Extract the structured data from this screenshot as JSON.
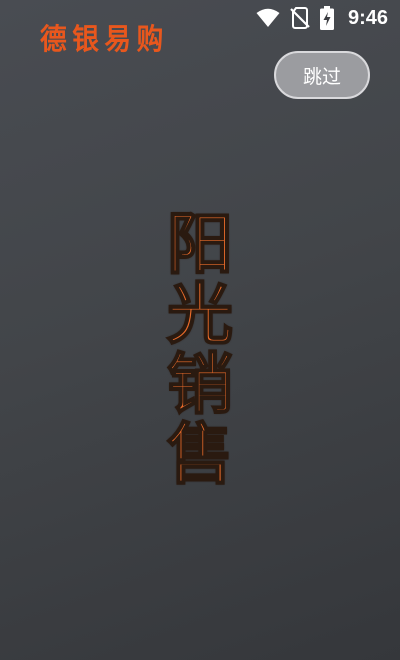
{
  "status_bar": {
    "time": "9:46",
    "icons": [
      "wifi-icon",
      "no-sim-icon",
      "battery-charging-icon"
    ]
  },
  "brand": {
    "name": "德银易购",
    "color": "#e8571d"
  },
  "skip_button": {
    "label": "跳过"
  },
  "slogan": {
    "chars": [
      "阳",
      "光",
      "销",
      "售"
    ],
    "color": "#ec6c2a"
  }
}
